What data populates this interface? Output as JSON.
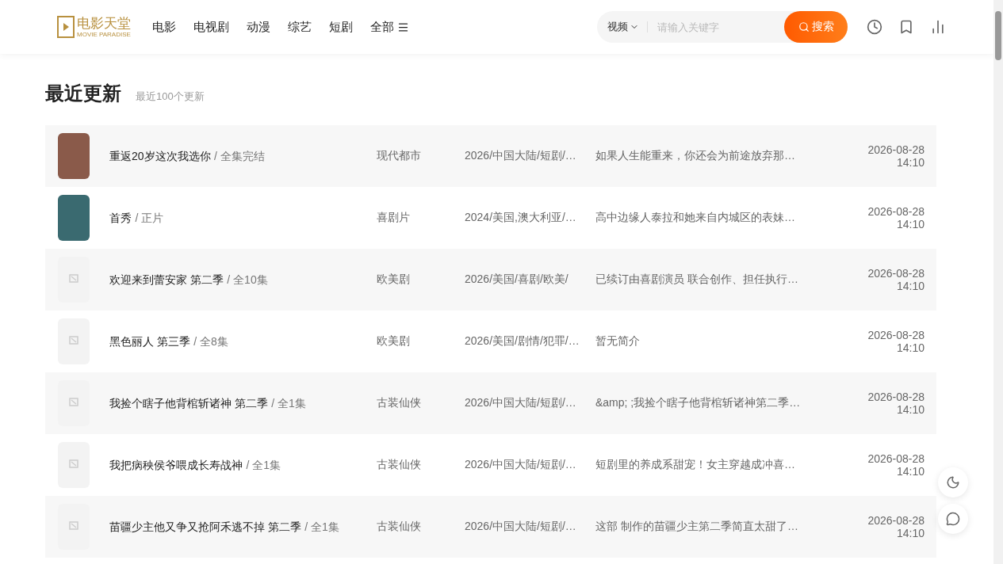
{
  "header": {
    "logo": {
      "title": "电影天堂",
      "subtitle": "MOVIE PARADISE"
    },
    "nav": [
      {
        "label": "电影",
        "menu": false
      },
      {
        "label": "电视剧",
        "menu": false
      },
      {
        "label": "动漫",
        "menu": false
      },
      {
        "label": "综艺",
        "menu": false
      },
      {
        "label": "短剧",
        "menu": false
      },
      {
        "label": "全部",
        "menu": true
      }
    ],
    "search": {
      "category": "视频",
      "placeholder": "请输入关键字",
      "button": "搜索"
    }
  },
  "section": {
    "title": "最近更新",
    "subtitle": "最近100个更新"
  },
  "rows": [
    {
      "kind": "photo",
      "color": "#8a5a4a",
      "title": "重返20岁这次我选你",
      "status": "/ 全集完结",
      "genre": "现代都市",
      "info": "2026/中国大陆/短剧/…",
      "desc": "如果人生能重来，你还会为前途放弃那…",
      "date": "2026-08-28",
      "time": "14:10"
    },
    {
      "kind": "photo",
      "color": "#3a6a70",
      "title": "首秀",
      "status": "/ 正片",
      "genre": "喜剧片",
      "info": "2024/美国,澳大利亚/…",
      "desc": "高中边缘人泰拉和她来自内城区的表妹…",
      "date": "2026-08-28",
      "time": "14:10"
    },
    {
      "kind": "placeholder",
      "title": "欢迎来到蕾安家 第二季",
      "status": "/ 全10集",
      "genre": "欧美剧",
      "info": "2026/美国/喜剧/欧美/",
      "desc": "已续订由喜剧演员 联合创作、担任执行…",
      "date": "2026-08-28",
      "time": "14:10"
    },
    {
      "kind": "placeholder",
      "title": "黑色丽人 第三季",
      "status": "/ 全8集",
      "genre": "欧美剧",
      "info": "2026/美国/剧情/犯罪/…",
      "desc": "暂无简介",
      "date": "2026-08-28",
      "time": "14:10"
    },
    {
      "kind": "placeholder",
      "title": "我捡个瞎子他背棺斩诸神 第二季",
      "status": "/ 全1集",
      "genre": "古装仙侠",
      "info": "2026/中国大陆/短剧/…",
      "desc": "&amp; ;我捡个瞎子他背棺斩诸神第二季…",
      "date": "2026-08-28",
      "time": "14:10"
    },
    {
      "kind": "placeholder",
      "title": "我把病秧侯爷喂成长寿战神",
      "status": "/ 全1集",
      "genre": "古装仙侠",
      "info": "2026/中国大陆/短剧/…",
      "desc": "短剧里的养成系甜宠！女主穿越成冲喜…",
      "date": "2026-08-28",
      "time": "14:10"
    },
    {
      "kind": "placeholder",
      "title": "苗疆少主他又争又抢阿禾逃不掉 第二季",
      "status": "/ 全1集",
      "genre": "古装仙侠",
      "info": "2026/中国大陆/短剧/…",
      "desc": "这部 制作的苗疆少主第二季简直太甜了…",
      "date": "2026-08-28",
      "time": "14:10"
    }
  ]
}
